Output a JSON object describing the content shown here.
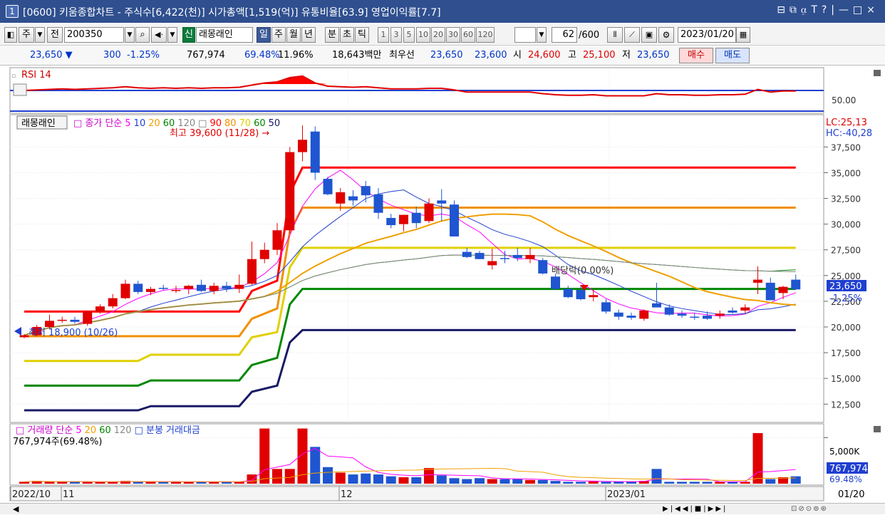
{
  "titlebar": {
    "window_num": "1",
    "title": "[0600] 키움종합차트 - 주식수[6,422(천)] 시가총액[1,519(억)] 유통비율[63.9] 영업이익률[7.7]",
    "controls": "⊟⧉⍶T?|—□×"
  },
  "toolbar": {
    "period_type": "주",
    "whole_label": "전",
    "code": "200350",
    "sin_badge": "신",
    "stock_name": "래몽래인",
    "tf_day": "일",
    "tf_week": "주",
    "tf_month": "월",
    "tf_year": "년",
    "tf_min": "분",
    "tf_sec": "초",
    "tf_tick": "틱",
    "n1": "1",
    "n3": "3",
    "n5": "5",
    "n10": "10",
    "n20": "20",
    "n30": "30",
    "n60": "60",
    "n120": "120",
    "count": "62",
    "count_max": "/600",
    "date": "2023/01/20"
  },
  "quote": {
    "price": "23,650 ▼",
    "change": "300",
    "change_pct": "-1.25%",
    "volume": "767,974",
    "vol_ratio": "69.48%",
    "turnover": "11.96%",
    "amount": "18,643백만",
    "best_label": "최우선",
    "best_ask": "23,650",
    "best_bid": "23,600",
    "open_label": "시",
    "open": "24,600",
    "high_label": "고",
    "high": "25,100",
    "low_label": "저",
    "low": "23,650",
    "buy": "매수",
    "sell": "매도"
  },
  "rsi_panel": {
    "title": "RSI 14",
    "axis_label": "50.00"
  },
  "price_panel": {
    "stock_tag": "래몽래인",
    "legend_main": "종가 단순",
    "ma": [
      "5",
      "10",
      "20",
      "60",
      "120"
    ],
    "ma_colors": [
      "#ff00ff",
      "#1f3fd0",
      "#f0a000",
      "#008800",
      "#888888"
    ],
    "env": [
      "90",
      "80",
      "70",
      "60",
      "50"
    ],
    "env_colors": [
      "#ff0000",
      "#f09000",
      "#e0d000",
      "#008800",
      "#1a1a66"
    ],
    "high_annot": "최고 39,600 (11/28) →",
    "low_annot": "최저 18,900 (10/26)",
    "div_annot": "배당락(0.00%)",
    "lc": "LC:25,13",
    "hc": "HC:-40,28",
    "y_ticks": [
      "37,500",
      "35,000",
      "32,500",
      "30,000",
      "27,500",
      "25,000",
      "22,500",
      "20,000",
      "17,500",
      "15,000",
      "12,500"
    ],
    "last_price": "23,650",
    "last_pct": "-1.25%"
  },
  "volume_panel": {
    "legend_main": "거래량 단순",
    "ma": [
      "5",
      "20",
      "60",
      "120"
    ],
    "legend_extra": "분봉 거래대금",
    "sub": "767,974주(69.48%)",
    "axis_label": "5,000K",
    "last_vol": "767,974",
    "last_pct": "69.48%"
  },
  "x_axis": {
    "labels": [
      "2022/10",
      "11",
      "12",
      "2023/01"
    ],
    "right_label": "01/20"
  },
  "chart_data": {
    "type": "candlestick",
    "y_range": [
      11000,
      40500
    ],
    "candles": [
      {
        "o": 19000,
        "h": 19300,
        "l": 18900,
        "c": 19200
      },
      {
        "o": 19200,
        "h": 20200,
        "l": 19100,
        "c": 20000
      },
      {
        "o": 20000,
        "h": 21200,
        "l": 19800,
        "c": 20600
      },
      {
        "o": 20600,
        "h": 21000,
        "l": 20400,
        "c": 20700
      },
      {
        "o": 20700,
        "h": 21000,
        "l": 20300,
        "c": 20500
      },
      {
        "o": 20300,
        "h": 21600,
        "l": 20100,
        "c": 21500
      },
      {
        "o": 21500,
        "h": 22200,
        "l": 21300,
        "c": 22000
      },
      {
        "o": 22000,
        "h": 23200,
        "l": 21800,
        "c": 22800
      },
      {
        "o": 22800,
        "h": 24600,
        "l": 22700,
        "c": 24200
      },
      {
        "o": 24200,
        "h": 24500,
        "l": 23200,
        "c": 23400
      },
      {
        "o": 23400,
        "h": 23900,
        "l": 23100,
        "c": 23700
      },
      {
        "o": 23800,
        "h": 24100,
        "l": 23600,
        "c": 23700
      },
      {
        "o": 23600,
        "h": 24000,
        "l": 23300,
        "c": 23600
      },
      {
        "o": 23700,
        "h": 24100,
        "l": 23200,
        "c": 24000
      },
      {
        "o": 24100,
        "h": 24600,
        "l": 23400,
        "c": 23500
      },
      {
        "o": 23500,
        "h": 24300,
        "l": 23200,
        "c": 24000
      },
      {
        "o": 24000,
        "h": 24400,
        "l": 23400,
        "c": 23700
      },
      {
        "o": 23700,
        "h": 25100,
        "l": 23300,
        "c": 24100
      },
      {
        "o": 24200,
        "h": 28300,
        "l": 24100,
        "c": 26600
      },
      {
        "o": 26600,
        "h": 28200,
        "l": 26200,
        "c": 27500
      },
      {
        "o": 27500,
        "h": 30100,
        "l": 27000,
        "c": 29400
      },
      {
        "o": 29400,
        "h": 37500,
        "l": 29100,
        "c": 37000
      },
      {
        "o": 37000,
        "h": 39600,
        "l": 36100,
        "c": 38200
      },
      {
        "o": 39000,
        "h": 39500,
        "l": 34300,
        "c": 35000
      },
      {
        "o": 34400,
        "h": 34600,
        "l": 32800,
        "c": 32900
      },
      {
        "o": 32000,
        "h": 33500,
        "l": 31300,
        "c": 33100
      },
      {
        "o": 32700,
        "h": 33300,
        "l": 31800,
        "c": 32300
      },
      {
        "o": 33700,
        "h": 34200,
        "l": 32100,
        "c": 32800
      },
      {
        "o": 32900,
        "h": 33500,
        "l": 30500,
        "c": 31100
      },
      {
        "o": 30600,
        "h": 31000,
        "l": 29600,
        "c": 29900
      },
      {
        "o": 30000,
        "h": 30900,
        "l": 29300,
        "c": 30900
      },
      {
        "o": 31100,
        "h": 31700,
        "l": 29600,
        "c": 30100
      },
      {
        "o": 30300,
        "h": 32500,
        "l": 30100,
        "c": 32000
      },
      {
        "o": 32300,
        "h": 33400,
        "l": 30300,
        "c": 32000
      },
      {
        "o": 31900,
        "h": 32300,
        "l": 28800,
        "c": 28800
      },
      {
        "o": 27300,
        "h": 27700,
        "l": 26700,
        "c": 26800
      },
      {
        "o": 27200,
        "h": 27400,
        "l": 26600,
        "c": 26600
      },
      {
        "o": 26000,
        "h": 27600,
        "l": 25600,
        "c": 26400
      },
      {
        "o": 26700,
        "h": 27400,
        "l": 26200,
        "c": 26600
      },
      {
        "o": 27000,
        "h": 27700,
        "l": 26400,
        "c": 26700
      },
      {
        "o": 26600,
        "h": 27700,
        "l": 26200,
        "c": 27000
      },
      {
        "o": 26500,
        "h": 26700,
        "l": 25100,
        "c": 25200
      },
      {
        "o": 24900,
        "h": 25200,
        "l": 23600,
        "c": 23700
      },
      {
        "o": 23700,
        "h": 24000,
        "l": 22800,
        "c": 22900
      },
      {
        "o": 23600,
        "h": 24000,
        "l": 22600,
        "c": 22700
      },
      {
        "o": 22900,
        "h": 23600,
        "l": 22500,
        "c": 23100
      },
      {
        "o": 22400,
        "h": 22700,
        "l": 21300,
        "c": 21500
      },
      {
        "o": 21400,
        "h": 21700,
        "l": 20700,
        "c": 21000
      },
      {
        "o": 21100,
        "h": 21400,
        "l": 20700,
        "c": 20900
      },
      {
        "o": 20800,
        "h": 21700,
        "l": 20600,
        "c": 21600
      },
      {
        "o": 22300,
        "h": 24300,
        "l": 22000,
        "c": 21900
      },
      {
        "o": 21900,
        "h": 22200,
        "l": 21100,
        "c": 21200
      },
      {
        "o": 21300,
        "h": 21600,
        "l": 20900,
        "c": 21100
      },
      {
        "o": 21000,
        "h": 21400,
        "l": 20700,
        "c": 20900
      },
      {
        "o": 21100,
        "h": 21500,
        "l": 20700,
        "c": 20800
      },
      {
        "o": 21100,
        "h": 21600,
        "l": 20800,
        "c": 21300
      },
      {
        "o": 21600,
        "h": 21900,
        "l": 21300,
        "c": 21400
      },
      {
        "o": 21600,
        "h": 22200,
        "l": 21300,
        "c": 21900
      },
      {
        "o": 24300,
        "h": 25900,
        "l": 23200,
        "c": 24600
      },
      {
        "o": 24300,
        "h": 24800,
        "l": 22600,
        "c": 22600
      },
      {
        "o": 23300,
        "h": 24000,
        "l": 22700,
        "c": 23900
      },
      {
        "o": 24600,
        "h": 25100,
        "l": 23650,
        "c": 23650
      }
    ],
    "volumes": [
      0.2,
      0.3,
      0.2,
      0.2,
      0.2,
      0.2,
      0.2,
      0.2,
      0.3,
      0.2,
      0.2,
      0.2,
      0.2,
      0.2,
      0.2,
      0.2,
      0.2,
      0.2,
      1.0,
      6.0,
      1.6,
      1.6,
      6.0,
      4.0,
      1.8,
      1.2,
      1.0,
      1.1,
      1.0,
      0.8,
      0.7,
      0.7,
      1.7,
      0.9,
      0.6,
      0.5,
      0.6,
      0.5,
      0.5,
      0.5,
      0.4,
      0.4,
      0.3,
      0.2,
      0.2,
      0.3,
      0.2,
      0.2,
      0.2,
      0.3,
      1.6,
      0.2,
      0.2,
      0.2,
      0.2,
      0.2,
      0.2,
      0.2,
      5.5,
      0.5,
      0.7,
      0.8
    ],
    "envelopes": [
      {
        "name": "90",
        "color": "#ff0000",
        "points": [
          [
            0,
            21500
          ],
          [
            17,
            21500
          ],
          [
            18,
            23500
          ],
          [
            20,
            24500
          ],
          [
            21,
            33000
          ],
          [
            22,
            35500
          ],
          [
            61,
            35500
          ]
        ]
      },
      {
        "name": "80",
        "color": "#f09000",
        "points": [
          [
            0,
            19100
          ],
          [
            17,
            19100
          ],
          [
            18,
            20800
          ],
          [
            20,
            21800
          ],
          [
            21,
            29300
          ],
          [
            22,
            31600
          ],
          [
            61,
            31600
          ]
        ]
      },
      {
        "name": "70",
        "color": "#e0d000",
        "points": [
          [
            0,
            16700
          ],
          [
            9,
            16700
          ],
          [
            10,
            17300
          ],
          [
            17,
            17300
          ],
          [
            18,
            19000
          ],
          [
            20,
            19500
          ],
          [
            21,
            25800
          ],
          [
            22,
            27700
          ],
          [
            61,
            27700
          ]
        ]
      },
      {
        "name": "60",
        "color": "#008800",
        "points": [
          [
            0,
            14300
          ],
          [
            9,
            14300
          ],
          [
            10,
            14800
          ],
          [
            17,
            14800
          ],
          [
            18,
            16300
          ],
          [
            20,
            17000
          ],
          [
            21,
            22200
          ],
          [
            22,
            23700
          ],
          [
            61,
            23700
          ]
        ]
      },
      {
        "name": "50",
        "color": "#1a1a66",
        "points": [
          [
            0,
            11900
          ],
          [
            9,
            11900
          ],
          [
            10,
            12300
          ],
          [
            17,
            12300
          ],
          [
            18,
            13700
          ],
          [
            20,
            14300
          ],
          [
            21,
            18500
          ],
          [
            22,
            19700
          ],
          [
            61,
            19700
          ]
        ]
      }
    ],
    "rsi": [
      50,
      50.5,
      51,
      51.5,
      51,
      51.5,
      52,
      52.5,
      53.5,
      52.5,
      52,
      52.5,
      52,
      52.5,
      52,
      52.5,
      52.5,
      53,
      55,
      57,
      58,
      62,
      63.5,
      57,
      54,
      53.5,
      53,
      53.5,
      52.5,
      51.5,
      51.5,
      51.5,
      52,
      52,
      50.5,
      48.5,
      48.5,
      48.5,
      48.5,
      48.5,
      48.5,
      47,
      46,
      45.5,
      45.5,
      46,
      45,
      45,
      45,
      45,
      47,
      46,
      46,
      45.5,
      45.5,
      46,
      46,
      46.5,
      51,
      48.5,
      49.5,
      49.5
    ]
  }
}
